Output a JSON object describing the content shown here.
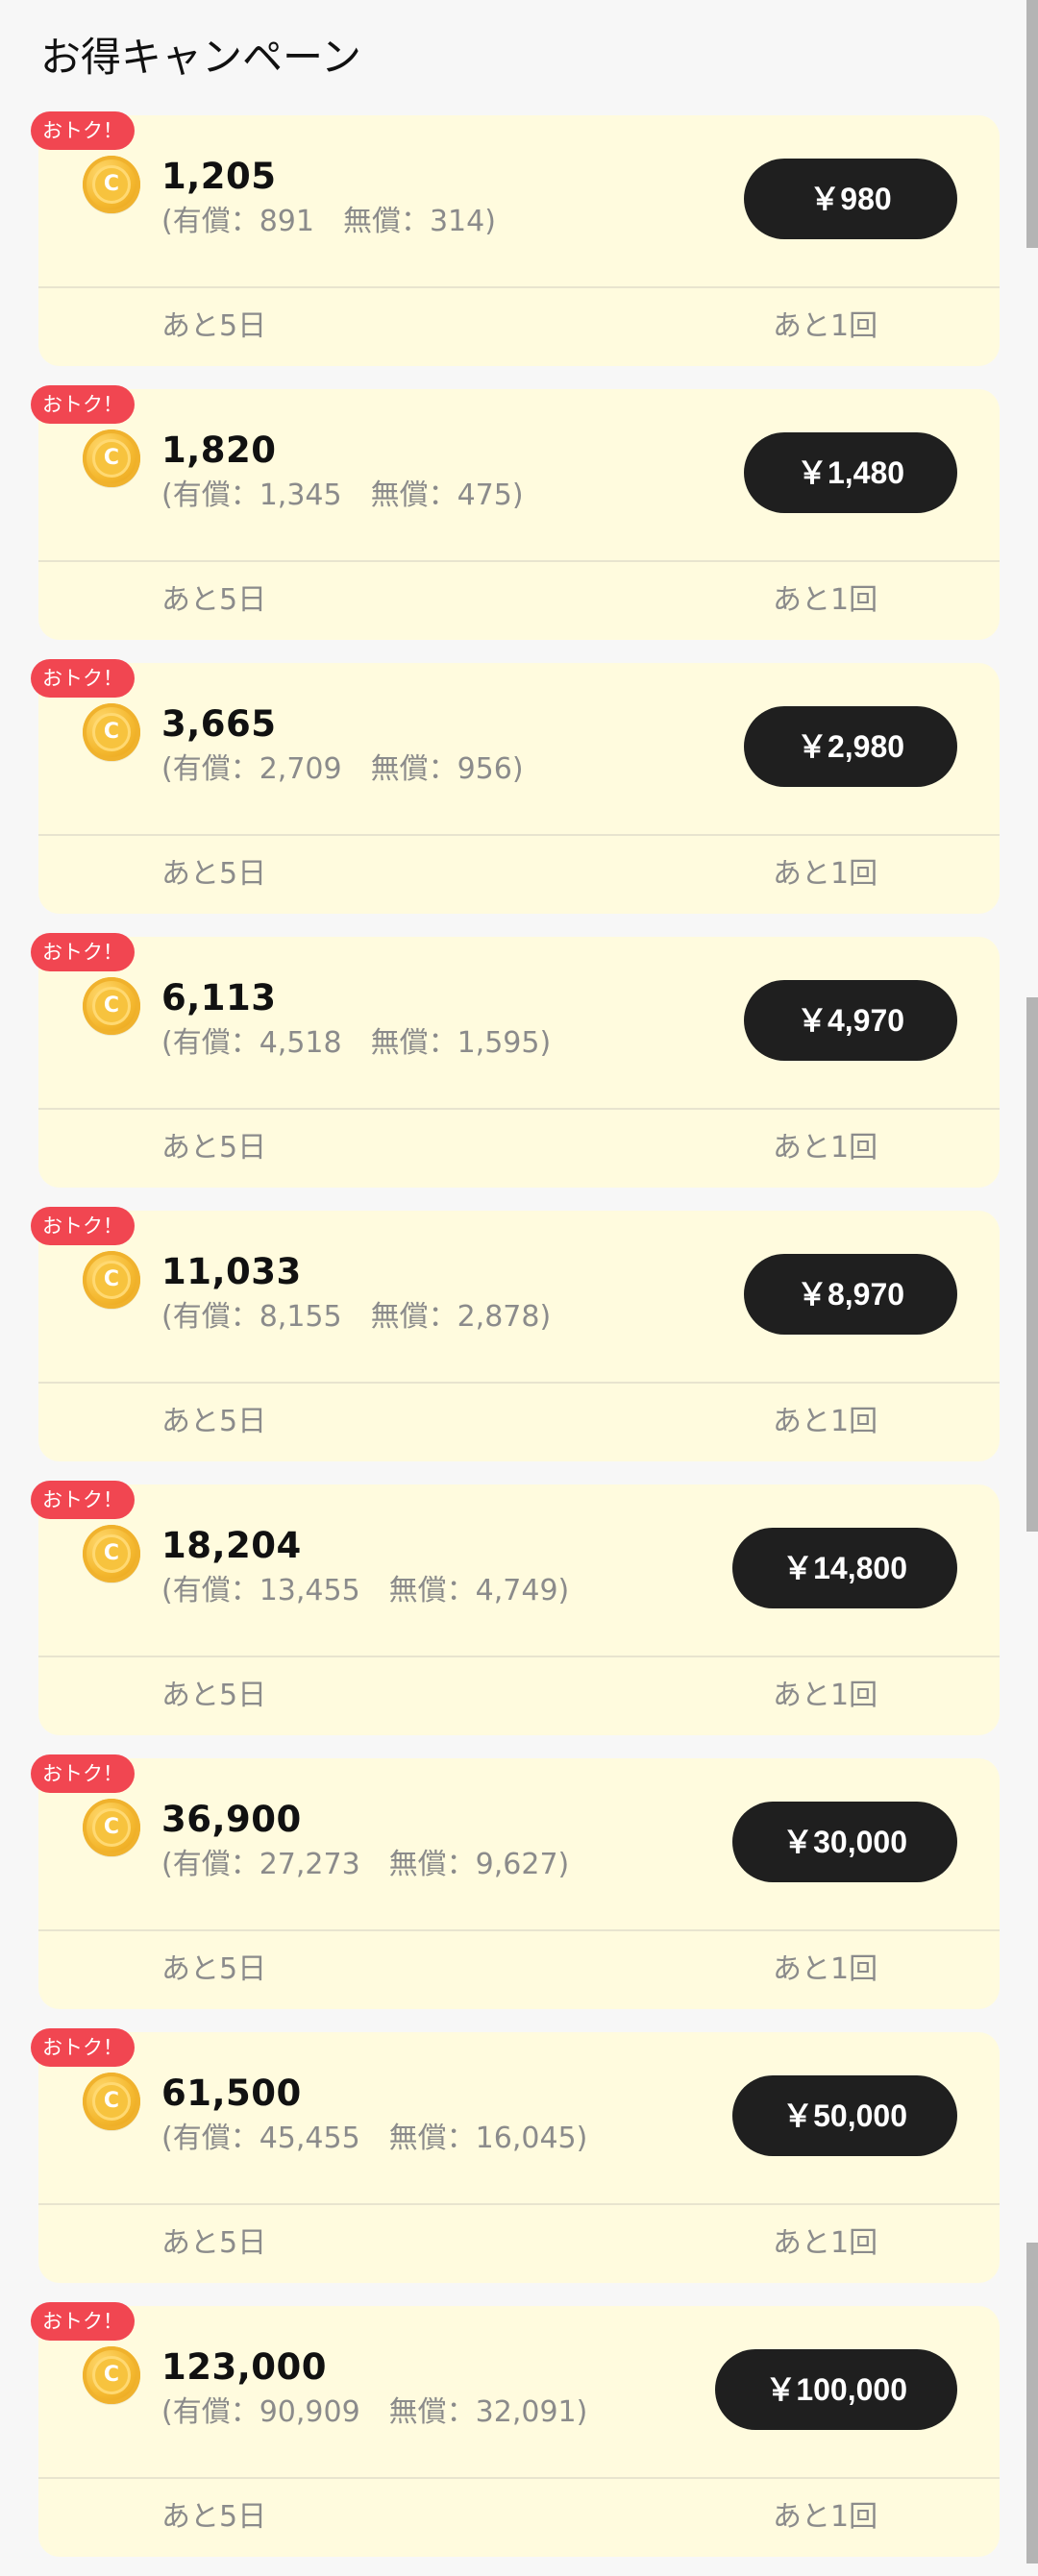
{
  "page": {
    "title": "お得キャンペーン"
  },
  "campaigns": [
    {
      "badge": "おトク！",
      "total": "1,205",
      "breakdown": "(有償：891　無償：314)",
      "price": "￥980",
      "days_left": "あと5日",
      "times_left": "あと1回"
    },
    {
      "badge": "おトク！",
      "total": "1,820",
      "breakdown": "(有償：1,345　無償：475)",
      "price": "￥1,480",
      "days_left": "あと5日",
      "times_left": "あと1回"
    },
    {
      "badge": "おトク！",
      "total": "3,665",
      "breakdown": "(有償：2,709　無償：956)",
      "price": "￥2,980",
      "days_left": "あと5日",
      "times_left": "あと1回"
    },
    {
      "badge": "おトク！",
      "total": "6,113",
      "breakdown": "(有償：4,518　無償：1,595)",
      "price": "￥4,970",
      "days_left": "あと5日",
      "times_left": "あと1回"
    },
    {
      "badge": "おトク！",
      "total": "11,033",
      "breakdown": "(有償：8,155　無償：2,878)",
      "price": "￥8,970",
      "days_left": "あと5日",
      "times_left": "あと1回"
    },
    {
      "badge": "おトク！",
      "total": "18,204",
      "breakdown": "(有償：13,455　無償：4,749)",
      "price": "￥14,800",
      "days_left": "あと5日",
      "times_left": "あと1回"
    },
    {
      "badge": "おトク！",
      "total": "36,900",
      "breakdown": "(有償：27,273　無償：9,627)",
      "price": "￥30,000",
      "days_left": "あと5日",
      "times_left": "あと1回"
    },
    {
      "badge": "おトク！",
      "total": "61,500",
      "breakdown": "(有償：45,455　無償：16,045)",
      "price": "￥50,000",
      "days_left": "あと5日",
      "times_left": "あと1回"
    },
    {
      "badge": "おトク！",
      "total": "123,000",
      "breakdown": "(有償：90,909　無償：32,091)",
      "price": "￥100,000",
      "days_left": "あと5日",
      "times_left": "あと1回"
    }
  ],
  "icons": {
    "coin": "coin-icon"
  },
  "colors": {
    "badge": "#f14651",
    "card_background": "#fffbde",
    "button_background": "#1f1f1f",
    "secondary_text": "#8b8b8b"
  }
}
